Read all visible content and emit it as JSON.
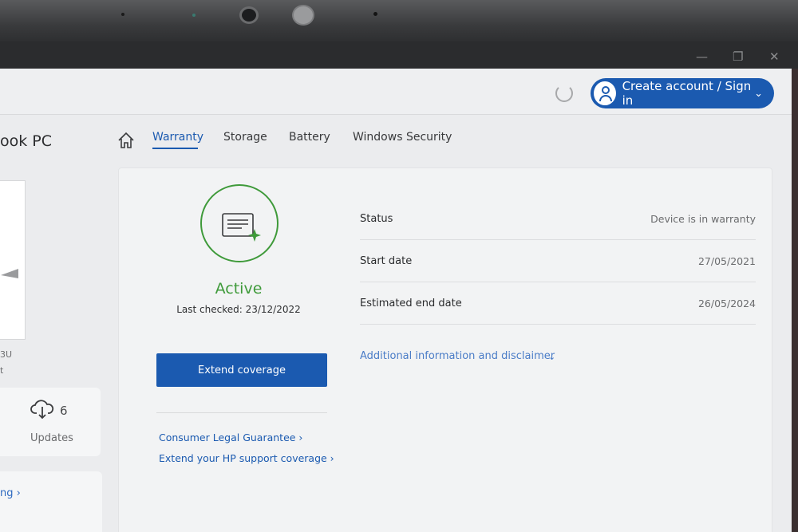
{
  "window": {
    "minimize_glyph": "—",
    "maximize_glyph": "❐",
    "close_glyph": "✕"
  },
  "header": {
    "signin_label": "Create account / Sign in",
    "refresh_icon": "refresh-icon",
    "user_icon": "user-icon"
  },
  "sidebar": {
    "device_title": "ook PC",
    "small_text_1": "3U",
    "small_text_2": "t",
    "updates_count": "6",
    "updates_label": "Updates",
    "partial_link": "ng ›"
  },
  "tabs": [
    {
      "label": "Warranty",
      "active": true
    },
    {
      "label": "Storage",
      "active": false
    },
    {
      "label": "Battery",
      "active": false
    },
    {
      "label": "Windows Security",
      "active": false
    }
  ],
  "warranty": {
    "status_text": "Active",
    "last_checked": "Last checked: 23/12/2022",
    "extend_label": "Extend coverage",
    "link_1": "Consumer Legal Guarantee ›",
    "link_2": "Extend your HP support coverage ›",
    "rows": [
      {
        "label": "Status",
        "value": "Device is in warranty"
      },
      {
        "label": "Start date",
        "value": "27/05/2021"
      },
      {
        "label": "Estimated end date",
        "value": "26/05/2024"
      }
    ],
    "disclaimer": "Additional information and disclaimer",
    "accent_color": "#3f9a3a",
    "brand_color": "#1b5ab0"
  }
}
